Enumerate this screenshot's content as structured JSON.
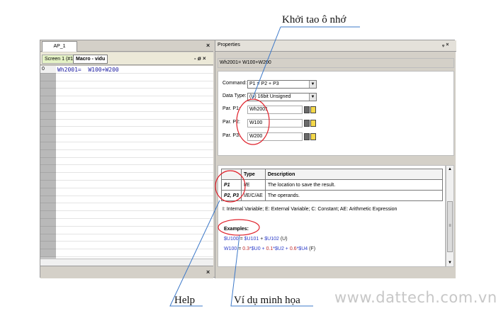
{
  "callouts": {
    "top": "Khởi tao ô nhớ",
    "help": "Help",
    "example": "Ví dụ minh họa"
  },
  "watermark": "www.dattech.com.vn",
  "left_pane": {
    "doc_tab": "AP_1",
    "tabs": [
      "Screen 1 (#1)",
      "Macro - vidu"
    ],
    "pane_controls": "- ø ×",
    "line_number": "0",
    "code_line": "Wh2001=  W100+W200"
  },
  "properties": {
    "title": "Properties",
    "window_controls": "ᵩ ×",
    "formula": "Wh2001= W100+W200",
    "command_label": "Command:",
    "command_value": "P1 = P2 + P3",
    "data_type_label": "Data Type:",
    "data_type_value": "(U) 16bit Unsigned",
    "p1_label": "Par. P1:",
    "p1_value": "Wh2001",
    "p2_label": "Par. P2:",
    "p2_value": "W100",
    "p3_label": "Par. P3:",
    "p3_value": "W200"
  },
  "help": {
    "headers": [
      "",
      "Type",
      "Description"
    ],
    "rows": [
      {
        "param": "P1",
        "type": "I/E",
        "desc": "The location to save the result."
      },
      {
        "param": "P2, P3",
        "type": "I/E/C/AE",
        "desc": "The operands."
      }
    ],
    "legend": "I: Internal Variable; E:  External Variable; C: Constant; AE: Arithmetic Expression",
    "examples_title": "Examples:",
    "ex1": {
      "a": "$U100",
      "b": " = ",
      "c": "$U101",
      "d": " + ",
      "e": "$U102",
      "f": " (U)"
    },
    "ex2": {
      "a": "W100",
      "b": " = ",
      "c": "0.3",
      "d": "*$U0 + ",
      "e": "0.1",
      "f": "*$U2 + ",
      "g": "0.6",
      "h": "*$U4",
      "i": " (F)"
    }
  },
  "colors": {
    "annotation_red": "#e0202a",
    "annotation_blue": "#3c78c8",
    "code_text": "#1a1aa0"
  }
}
